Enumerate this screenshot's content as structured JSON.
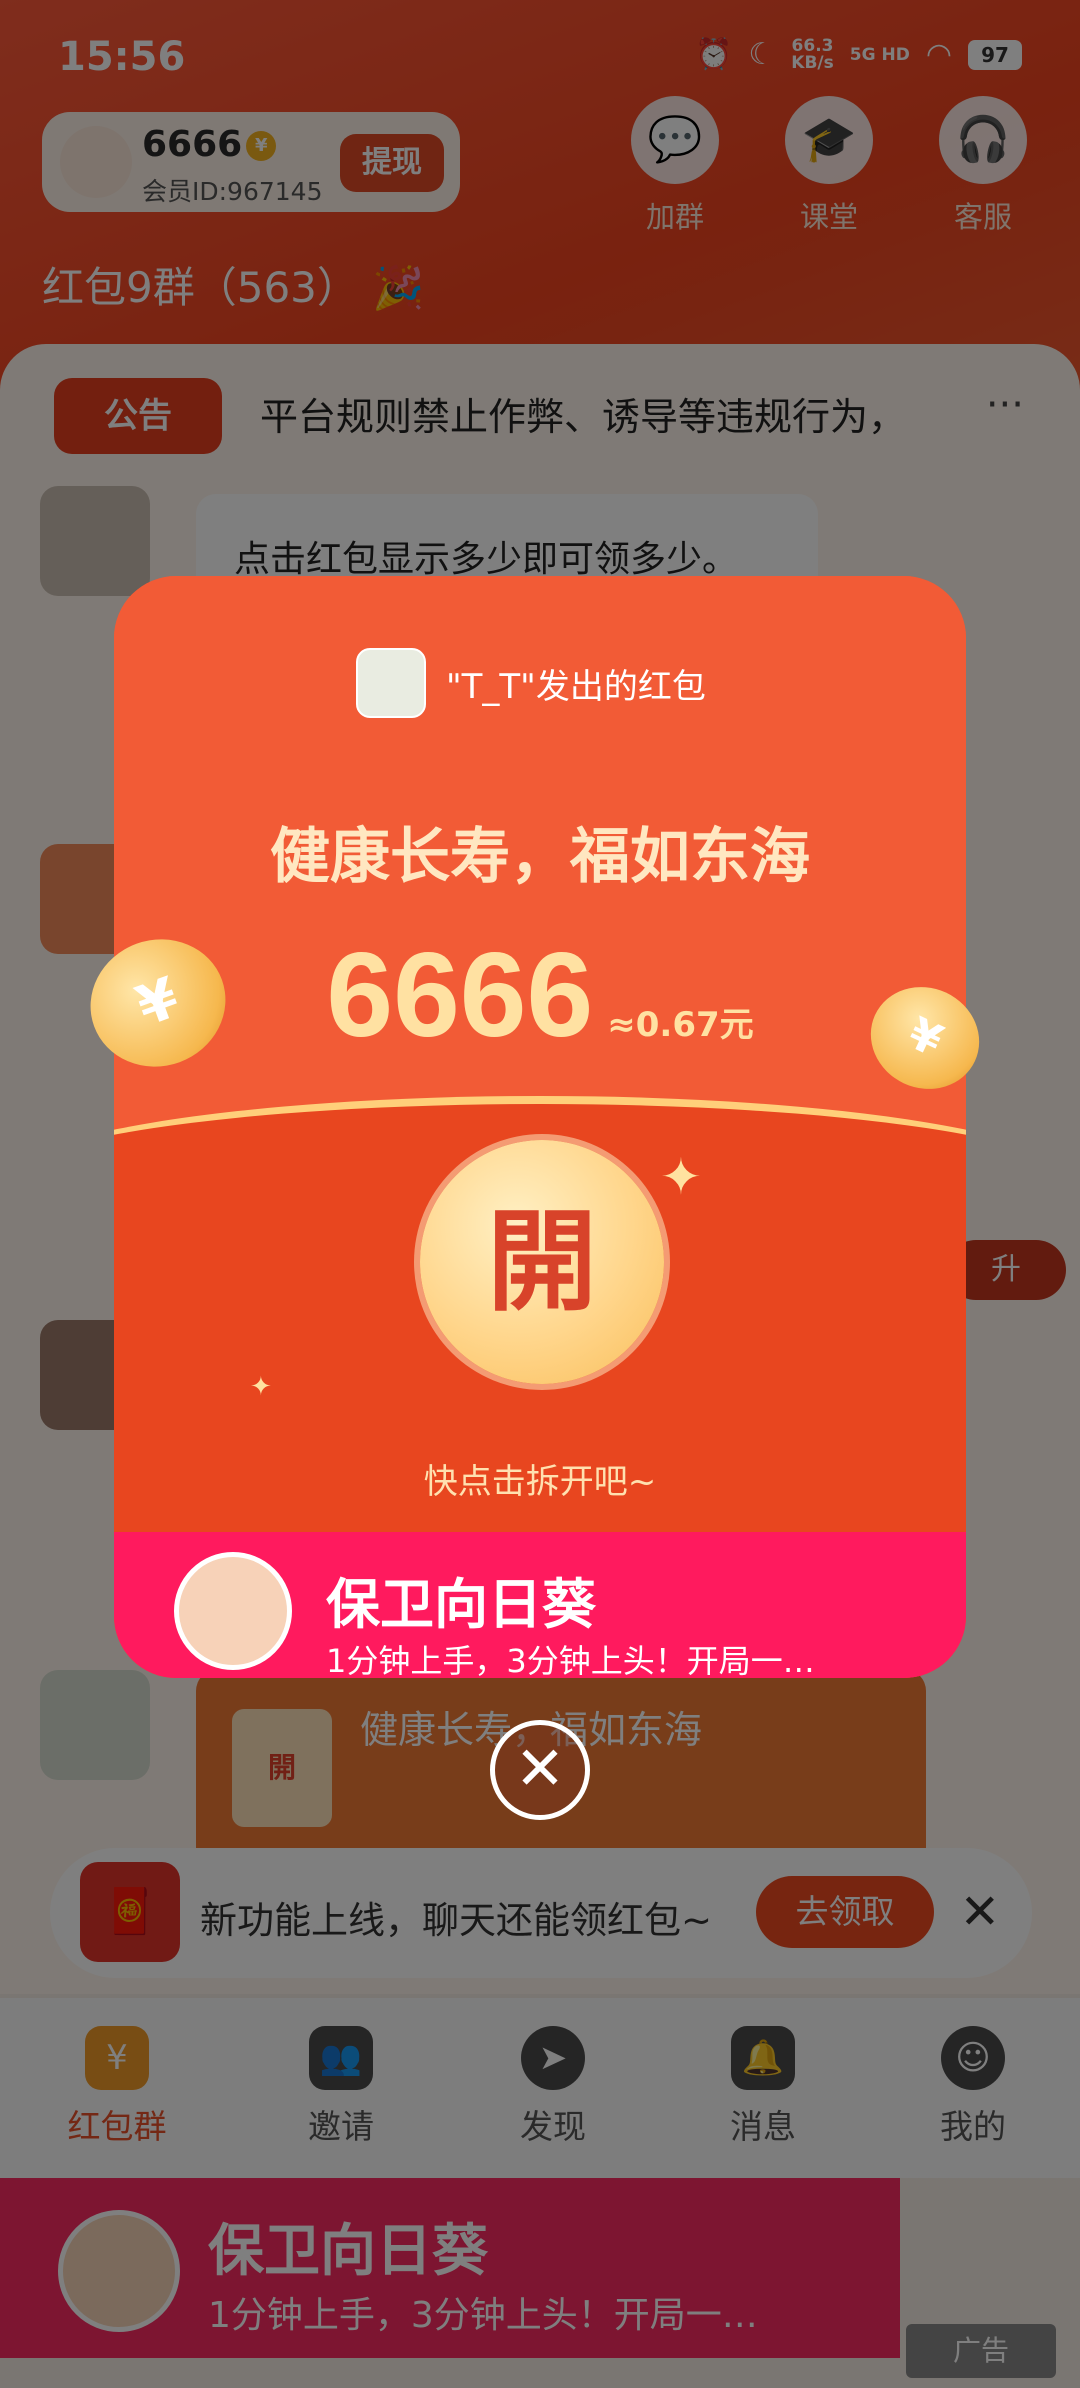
{
  "status_bar": {
    "time": "15:56",
    "net_speed_value": "66.3",
    "net_speed_unit": "KB/s",
    "network": "5G HD",
    "battery": "97"
  },
  "user": {
    "coins": "6666",
    "member_id": "会员ID:967145",
    "withdraw_label": "提现"
  },
  "top_actions": [
    {
      "label": "加群",
      "icon": "group-chat-icon"
    },
    {
      "label": "课堂",
      "icon": "graduation-cap-icon"
    },
    {
      "label": "客服",
      "icon": "headset-icon"
    }
  ],
  "group_title": "红包9群（563）",
  "announcement": {
    "tag": "公告",
    "text": "平台规则禁止作弊、诱导等违规行为，",
    "more": "···"
  },
  "chat": {
    "bubble_text": "点击红包显示多少即可领多少。",
    "redpacket_text": "健康长寿，福如东海",
    "redpacket_icon_text": "開",
    "side_badge": "升"
  },
  "promo_bar": {
    "text": "新功能上线，聊天还能领红包~",
    "button": "去领取"
  },
  "tabs": [
    {
      "label": "红包群",
      "icon": "red-envelope-icon",
      "active": true
    },
    {
      "label": "邀请",
      "icon": "invite-icon"
    },
    {
      "label": "发现",
      "icon": "compass-icon"
    },
    {
      "label": "消息",
      "icon": "bell-icon"
    },
    {
      "label": "我的",
      "icon": "profile-icon"
    }
  ],
  "bottom_ad": {
    "title": "保卫向日葵",
    "subtitle": "1分钟上手，3分钟上头！开局一…",
    "tag": "广告"
  },
  "packet": {
    "sender": "\"T_T\"发出的红包",
    "blessing": "健康长寿，福如东海",
    "amount": "6666",
    "approx": "≈0.67元",
    "open_label": "開",
    "hint": "快点击拆开吧~",
    "ad_title": "保卫向日葵",
    "ad_subtitle": "1分钟上手，3分钟上头！开局一…"
  },
  "colors": {
    "brand_red": "#ef4a20",
    "packet_red": "#f25b36",
    "gold": "#ffd58a",
    "ad_pink": "#ff1a5e"
  }
}
